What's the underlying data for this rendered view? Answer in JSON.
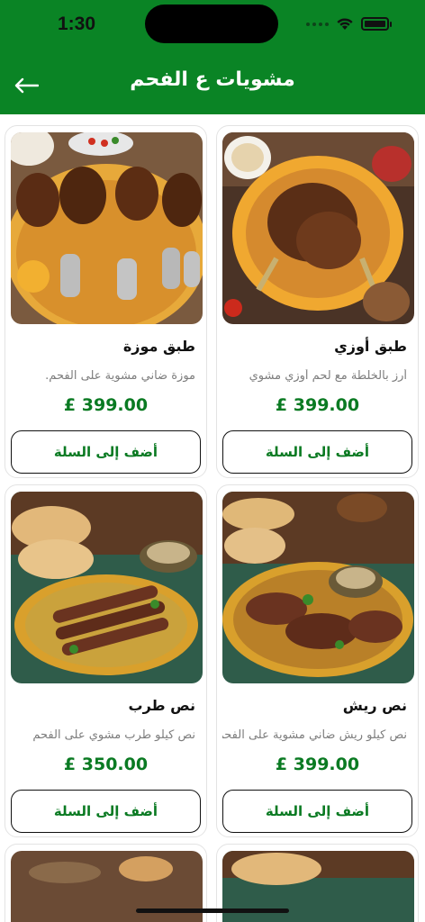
{
  "status": {
    "time": "1:30"
  },
  "header": {
    "title": "مشويات ع الفحم"
  },
  "products": [
    {
      "name": "طبق أوزي",
      "description": "أرز بالخلطة مع لحم أوزي مشوي",
      "price": "£ 399.00",
      "button": "أضف إلى السلة"
    },
    {
      "name": "طبق موزة",
      "description": "موزة ضاني مشوية على الفحم.",
      "price": "£ 399.00",
      "button": "أضف إلى السلة"
    },
    {
      "name": "نص ريش",
      "description": "نص كيلو ريش ضاني مشوية على الفحم",
      "price": "£ 399.00",
      "button": "أضف إلى السلة"
    },
    {
      "name": "نص طرب",
      "description": "نص كيلو طرب مشوي على الفحم",
      "price": "£ 350.00",
      "button": "أضف إلى السلة"
    }
  ],
  "colors": {
    "brand": "#0a8425",
    "price": "#0a7a22"
  }
}
